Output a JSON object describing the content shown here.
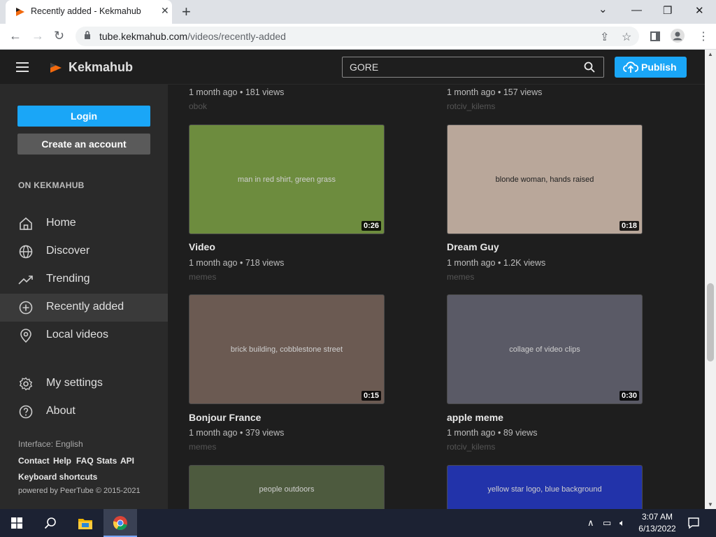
{
  "browser": {
    "tab_title": "Recently added - Kekmahub",
    "tab_close": "✕",
    "new_tab": "+",
    "url_host": "tube.kekmahub.com",
    "url_path": "/videos/recently-added",
    "window": {
      "minimize": "⌄",
      "restore": "—",
      "maximize": "❐",
      "close": "✕"
    }
  },
  "site": {
    "brand": "Kekmahub",
    "search_value": "GORE",
    "publish_label": "Publish"
  },
  "sidebar": {
    "login": "Login",
    "create_account": "Create an account",
    "section_title": "ON KEKMAHUB",
    "items": [
      {
        "label": "Home"
      },
      {
        "label": "Discover"
      },
      {
        "label": "Trending"
      },
      {
        "label": "Recently added"
      },
      {
        "label": "Local videos"
      },
      {
        "label": "My settings"
      },
      {
        "label": "About"
      }
    ],
    "interface": "Interface: English",
    "links": [
      "Contact",
      "Help",
      "FAQ",
      "Stats",
      "API",
      "Keyboard shortcuts"
    ],
    "powered": "powered by PeerTube © 2015-2021"
  },
  "videos": [
    {
      "title": "",
      "meta": "1 month ago • 181 views",
      "channel": "obok"
    },
    {
      "title": "",
      "meta": "1 month ago • 157 views",
      "channel": "rotciv_kilems"
    },
    {
      "title": "Video",
      "meta": "1 month ago • 718 views",
      "channel": "memes",
      "duration": "0:26",
      "thumb": "man in red shirt, green grass"
    },
    {
      "title": "Dream Guy",
      "meta": "1 month ago • 1.2K views",
      "channel": "memes",
      "duration": "0:18",
      "thumb": "blonde woman, hands raised"
    },
    {
      "title": "Bonjour France",
      "meta": "1 month ago • 379 views",
      "channel": "memes",
      "duration": "0:15",
      "thumb": "brick building, cobblestone street"
    },
    {
      "title": "apple meme",
      "meta": "1 month ago • 89 views",
      "channel": "rotciv_kilems",
      "duration": "0:30",
      "thumb": "collage of video clips"
    },
    {
      "title": "",
      "meta": "",
      "channel": "",
      "thumb": "people outdoors"
    },
    {
      "title": "",
      "meta": "",
      "channel": "",
      "thumb": "yellow star logo, blue background"
    }
  ],
  "taskbar": {
    "time": "3:07 AM",
    "date": "6/13/2022"
  }
}
